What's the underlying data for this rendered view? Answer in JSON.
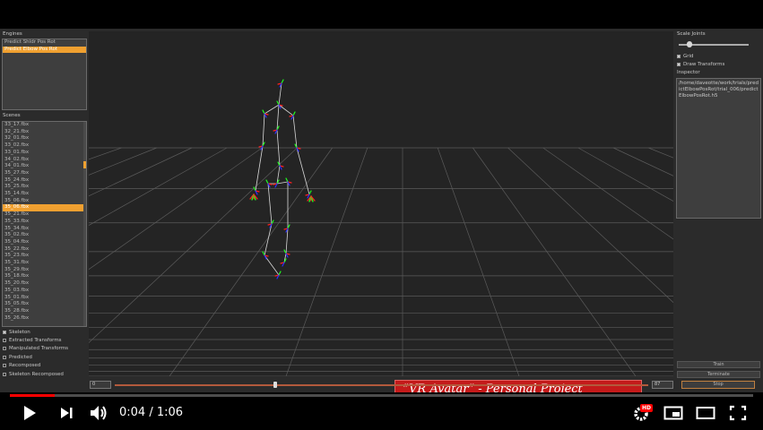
{
  "panels": {
    "engines": {
      "title": "Engines",
      "items": [
        "Predict Shldr Pos Rot",
        "Predict Elbow Pos Rot"
      ],
      "selected_index": 1
    },
    "scenes": {
      "title": "Scenes",
      "items": [
        "33_17.fbx",
        "32_21.fbx",
        "32_01.fbx",
        "33_02.fbx",
        "33_01.fbx",
        "34_02.fbx",
        "34_01.fbx",
        "35_27.fbx",
        "35_24.fbx",
        "35_25.fbx",
        "35_14.fbx",
        "35_06.fbx",
        "35_06.fbx",
        "35_21.fbx",
        "35_33.fbx",
        "35_34.fbx",
        "35_02.fbx",
        "35_04.fbx",
        "35_22.fbx",
        "35_23.fbx",
        "35_31.fbx",
        "35_29.fbx",
        "35_18.fbx",
        "35_20.fbx",
        "35_03.fbx",
        "35_01.fbx",
        "35_05.fbx",
        "35_28.fbx",
        "35_26.fbx"
      ],
      "selected_index": 12
    },
    "display_toggles": [
      {
        "label": "Skeleton",
        "checked": true
      },
      {
        "label": "Extracted Transforms",
        "checked": false
      },
      {
        "label": "Manipulated Transforms",
        "checked": false
      },
      {
        "label": "Predicted",
        "checked": false
      },
      {
        "label": "Recomposed",
        "checked": false
      },
      {
        "label": "Skeleton Recomposed",
        "checked": false
      }
    ],
    "right": {
      "scale_joints_label": "Scale Joints",
      "scale_joints_value": 0.15,
      "grid_label": "Grid",
      "draw_transforms_label": "Draw Transforms",
      "inspector_label": "Inspector",
      "inspector_text": "/home/daveotte/work/trials/predictElbowPosRot/trial_006/predictElbowPosRot.h5",
      "train_label": "Train",
      "terminate_label": "Terminate",
      "stop_label": "Stop"
    },
    "timeline": {
      "start_value": "0",
      "end_value": "87",
      "position": 0.3
    }
  },
  "overlay": {
    "banner_text": "“VR Avatar” - Personal Project",
    "banner_color": "#c41a1a"
  },
  "player": {
    "time_current": "0:04",
    "time_separator": " / ",
    "time_total": "1:06",
    "progress_played": 0.06,
    "progress_color": "#ff0000",
    "hd_badge": "HD",
    "icons": [
      "play-icon",
      "next-icon",
      "volume-icon",
      "settings-icon",
      "miniplayer-icon",
      "theater-icon",
      "fullscreen-icon"
    ]
  },
  "colors": {
    "panel_bg": "#2b2b2b",
    "viewport_bg": "#242424",
    "selection": "#f0a030",
    "bone_x": "#ff2020",
    "bone_y": "#20ff20",
    "bone_z": "#3030ff"
  }
}
